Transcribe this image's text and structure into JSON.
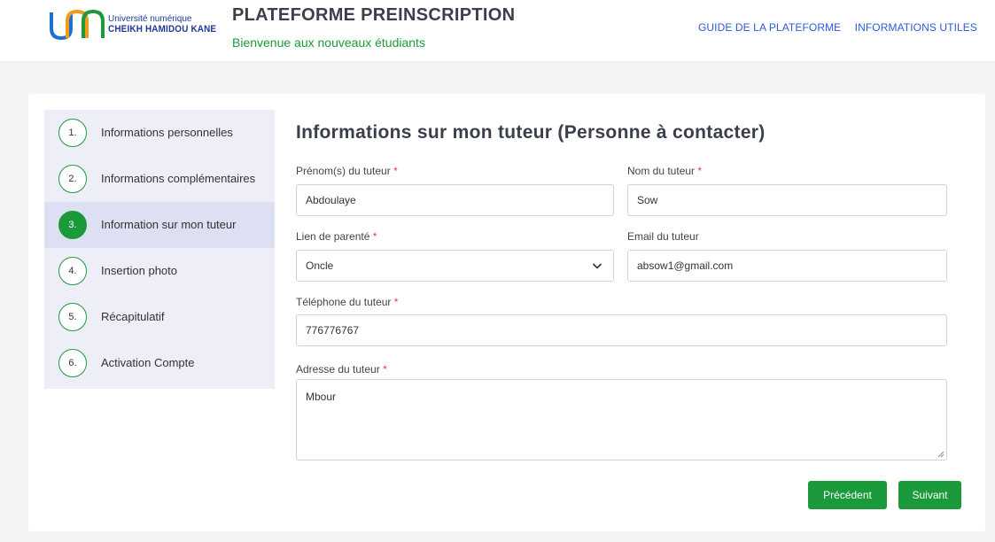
{
  "header": {
    "logo_line1": "Université numérique",
    "logo_line2": "CHEIKH HAMIDOU KANE",
    "title": "PLATEFORME PREINSCRIPTION",
    "subtitle": "Bienvenue aux nouveaux étudiants",
    "nav": [
      "GUIDE DE LA PLATEFORME",
      "INFORMATIONS UTILES"
    ]
  },
  "steps": [
    {
      "num": "1.",
      "label": "Informations personnelles",
      "active": false
    },
    {
      "num": "2.",
      "label": "Informations complémentaires",
      "active": false
    },
    {
      "num": "3.",
      "label": "Information sur mon tuteur",
      "active": true
    },
    {
      "num": "4.",
      "label": "Insertion photo",
      "active": false
    },
    {
      "num": "5.",
      "label": "Récapitulatif",
      "active": false
    },
    {
      "num": "6.",
      "label": "Activation Compte",
      "active": false
    }
  ],
  "form": {
    "title": "Informations sur mon tuteur (Personne à contacter)",
    "required_mark": "*",
    "prenom_label": "Prénom(s) du tuteur",
    "prenom_value": "Abdoulaye",
    "nom_label": "Nom du tuteur",
    "nom_value": "Sow",
    "lien_label": "Lien de parenté",
    "lien_value": "Oncle",
    "email_label": "Email du tuteur",
    "email_value": "absow1@gmail.com",
    "tel_label": "Téléphone du tuteur",
    "tel_value": "776776767",
    "adresse_label": "Adresse du tuteur",
    "adresse_value": "Mbour"
  },
  "buttons": {
    "previous": "Précédent",
    "next": "Suivant"
  },
  "colors": {
    "accent_green": "#1a9a3a",
    "link_blue": "#2b5bd7",
    "required_red": "#e0413a"
  }
}
